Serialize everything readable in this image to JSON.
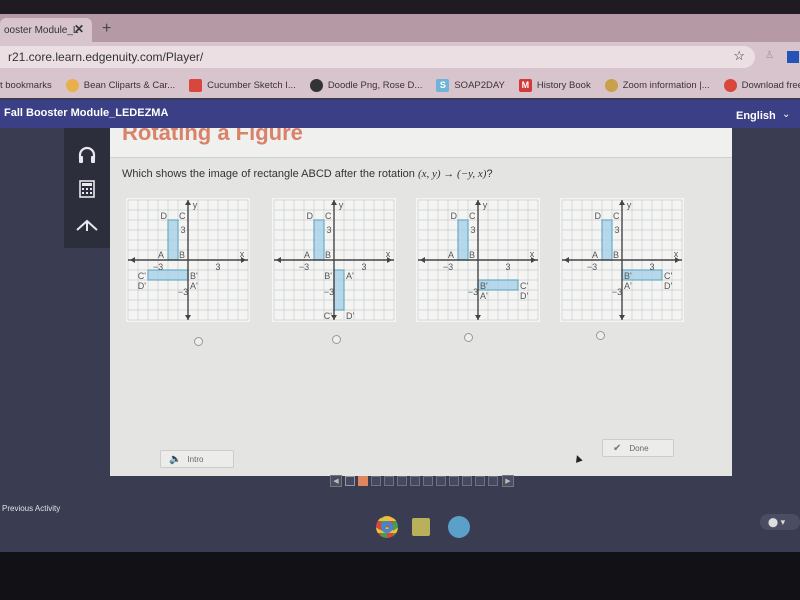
{
  "browser": {
    "tab": {
      "title": "ooster Module_L",
      "close": "✕"
    },
    "new_tab": "+",
    "url": "r21.core.learn.edgenuity.com/Player/",
    "bookmarks": [
      {
        "label": "t bookmarks",
        "icon": "",
        "color": ""
      },
      {
        "label": "Bean Cliparts & Car...",
        "icon": "bean-icon",
        "color": "#e8b04a"
      },
      {
        "label": "Cucumber Sketch I...",
        "icon": "cucumber-icon",
        "color": "#d9463b"
      },
      {
        "label": "Doodle Png, Rose D...",
        "icon": "globe-icon",
        "color": "#333333"
      },
      {
        "label": "SOAP2DAY",
        "icon": "s-icon",
        "color": "#6fb3d8"
      },
      {
        "label": "History Book",
        "icon": "m-icon",
        "color": "#d23a3a"
      },
      {
        "label": "Zoom information |...",
        "icon": "zoom-icon",
        "color": "#c9a04b"
      },
      {
        "label": "Download free Arm...",
        "icon": "download-icon",
        "color": "#d9463b"
      }
    ]
  },
  "app": {
    "course_title": "Fall Booster Module_LEDEZMA",
    "language": "English",
    "lesson_title": "Rotating a Figure",
    "question_prefix": "Which shows the image of rectangle ABCD after the rotation ",
    "question_math": "(x, y) → (−y, x)",
    "question_suffix": "?",
    "intro_label": "Intro",
    "done_label": "Done",
    "previous_activity": "Previous Activity",
    "nav": {
      "total": 12,
      "current": 2,
      "visited": [
        1
      ]
    }
  },
  "graphs": {
    "axis_labels": {
      "x": "x",
      "y": "y",
      "tick_pos": "3",
      "tick_neg": "−3"
    },
    "original": {
      "A": [
        -2,
        0
      ],
      "B": [
        -1,
        0
      ],
      "C": [
        -1,
        4
      ],
      "D": [
        -2,
        4
      ],
      "labels": {
        "A": "A",
        "B": "B",
        "C": "C",
        "D": "D"
      }
    },
    "options": [
      {
        "A'": [
          0,
          -2
        ],
        "B'": [
          0,
          -1
        ],
        "C'": [
          -4,
          -1
        ],
        "D'": [
          -4,
          -2
        ]
      },
      {
        "A'": [
          1,
          -1
        ],
        "B'": [
          0,
          -1
        ],
        "C'": [
          0,
          -5
        ],
        "D'": [
          1,
          -5
        ]
      },
      {
        "A'": [
          0,
          -3
        ],
        "B'": [
          0,
          -2
        ],
        "C'": [
          4,
          -2
        ],
        "D'": [
          4,
          -3
        ]
      },
      {
        "A'": [
          0,
          -2
        ],
        "B'": [
          0,
          -1
        ],
        "C'": [
          4,
          -1
        ],
        "D'": [
          4,
          -2
        ]
      }
    ],
    "option_label_anchors": [
      {
        "A'": "right",
        "B'": "right",
        "C'": "left",
        "D'": "left"
      },
      {
        "A'": "right",
        "B'": "left",
        "C'": "left",
        "D'": "right"
      },
      {
        "A'": "right",
        "B'": "right",
        "C'": "right",
        "D'": "right"
      },
      {
        "A'": "right",
        "B'": "right",
        "C'": "right",
        "D'": "right"
      }
    ]
  },
  "colors": {
    "header": "#3b3f86",
    "accent": "#e0855e",
    "rect_fill": "#a9d3e8",
    "rect_stroke": "#6ea9c6"
  }
}
